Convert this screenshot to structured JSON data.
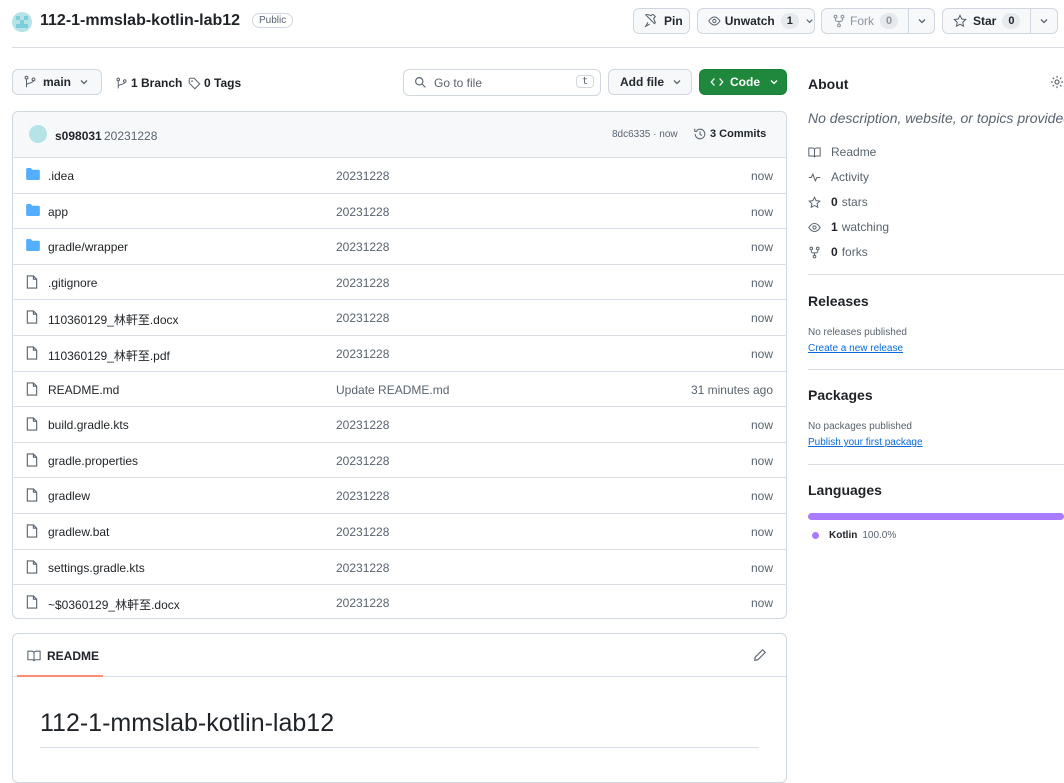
{
  "repo": {
    "name": "112-1-mmslab-kotlin-lab12",
    "visibility": "Public"
  },
  "actions": {
    "pin": "Pin",
    "unwatch": "Unwatch",
    "unwatch_count": "1",
    "fork": "Fork",
    "fork_count": "0",
    "star": "Star",
    "star_count": "0"
  },
  "toolbar": {
    "branch": "main",
    "branches": "1 Branch",
    "tags": "0 Tags",
    "search_placeholder": "Go to file",
    "search_key": "t",
    "add_file": "Add file",
    "code": "Code"
  },
  "commit": {
    "author": "s098031",
    "message": "20231228",
    "hash": "8dc6335 · now",
    "commits": "3 Commits"
  },
  "files": [
    {
      "type": "folder",
      "name": ".idea",
      "message": "20231228",
      "time": "now"
    },
    {
      "type": "folder",
      "name": "app",
      "message": "20231228",
      "time": "now"
    },
    {
      "type": "folder",
      "name": "gradle/wrapper",
      "message": "20231228",
      "time": "now"
    },
    {
      "type": "file",
      "name": ".gitignore",
      "message": "20231228",
      "time": "now"
    },
    {
      "type": "file",
      "name": "110360129_林軒至.docx",
      "message": "20231228",
      "time": "now"
    },
    {
      "type": "file",
      "name": "110360129_林軒至.pdf",
      "message": "20231228",
      "time": "now"
    },
    {
      "type": "file",
      "name": "README.md",
      "message": "Update README.md",
      "time": "31 minutes ago"
    },
    {
      "type": "file",
      "name": "build.gradle.kts",
      "message": "20231228",
      "time": "now"
    },
    {
      "type": "file",
      "name": "gradle.properties",
      "message": "20231228",
      "time": "now"
    },
    {
      "type": "file",
      "name": "gradlew",
      "message": "20231228",
      "time": "now"
    },
    {
      "type": "file",
      "name": "gradlew.bat",
      "message": "20231228",
      "time": "now"
    },
    {
      "type": "file",
      "name": "settings.gradle.kts",
      "message": "20231228",
      "time": "now"
    },
    {
      "type": "file",
      "name": "~$0360129_林軒至.docx",
      "message": "20231228",
      "time": "now"
    }
  ],
  "readme": {
    "tab": "README",
    "heading": "112-1-mmslab-kotlin-lab12"
  },
  "about": {
    "title": "About",
    "description": "No description, website, or topics provided.",
    "readme": "Readme",
    "activity": "Activity",
    "stars": "0",
    "stars_label": "stars",
    "watching": "1",
    "watching_label": "watching",
    "forks": "0",
    "forks_label": "forks"
  },
  "releases": {
    "title": "Releases",
    "empty": "No releases published",
    "link": "Create a new release"
  },
  "packages": {
    "title": "Packages",
    "empty": "No packages published",
    "link": "Publish your first package"
  },
  "languages": {
    "title": "Languages",
    "name": "Kotlin",
    "percent": "100.0%",
    "color": "#A97BFF"
  }
}
